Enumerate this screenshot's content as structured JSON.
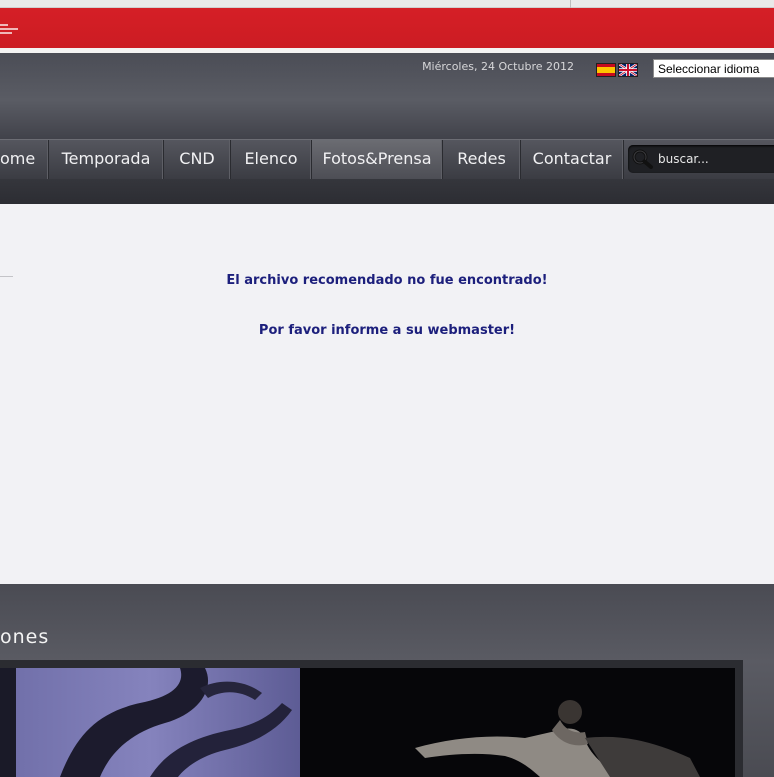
{
  "header": {
    "date": "Miércoles, 24 Octubre 2012",
    "language_select": "Seleccionar idioma"
  },
  "nav": {
    "items": [
      {
        "label": "ome"
      },
      {
        "label": "Temporada"
      },
      {
        "label": "CND"
      },
      {
        "label": "Elenco"
      },
      {
        "label": "Fotos&Prensa"
      },
      {
        "label": "Redes"
      },
      {
        "label": "Contactar"
      }
    ],
    "active_index": 4,
    "search_placeholder": "buscar..."
  },
  "content": {
    "message_1": "El archivo recomendado no fue encontrado!",
    "message_2": "Por favor informe a su webmaster!"
  },
  "footer": {
    "section_title": "ones"
  },
  "colors": {
    "brand_red": "#d51f26",
    "message_text": "#1c1f7c"
  }
}
